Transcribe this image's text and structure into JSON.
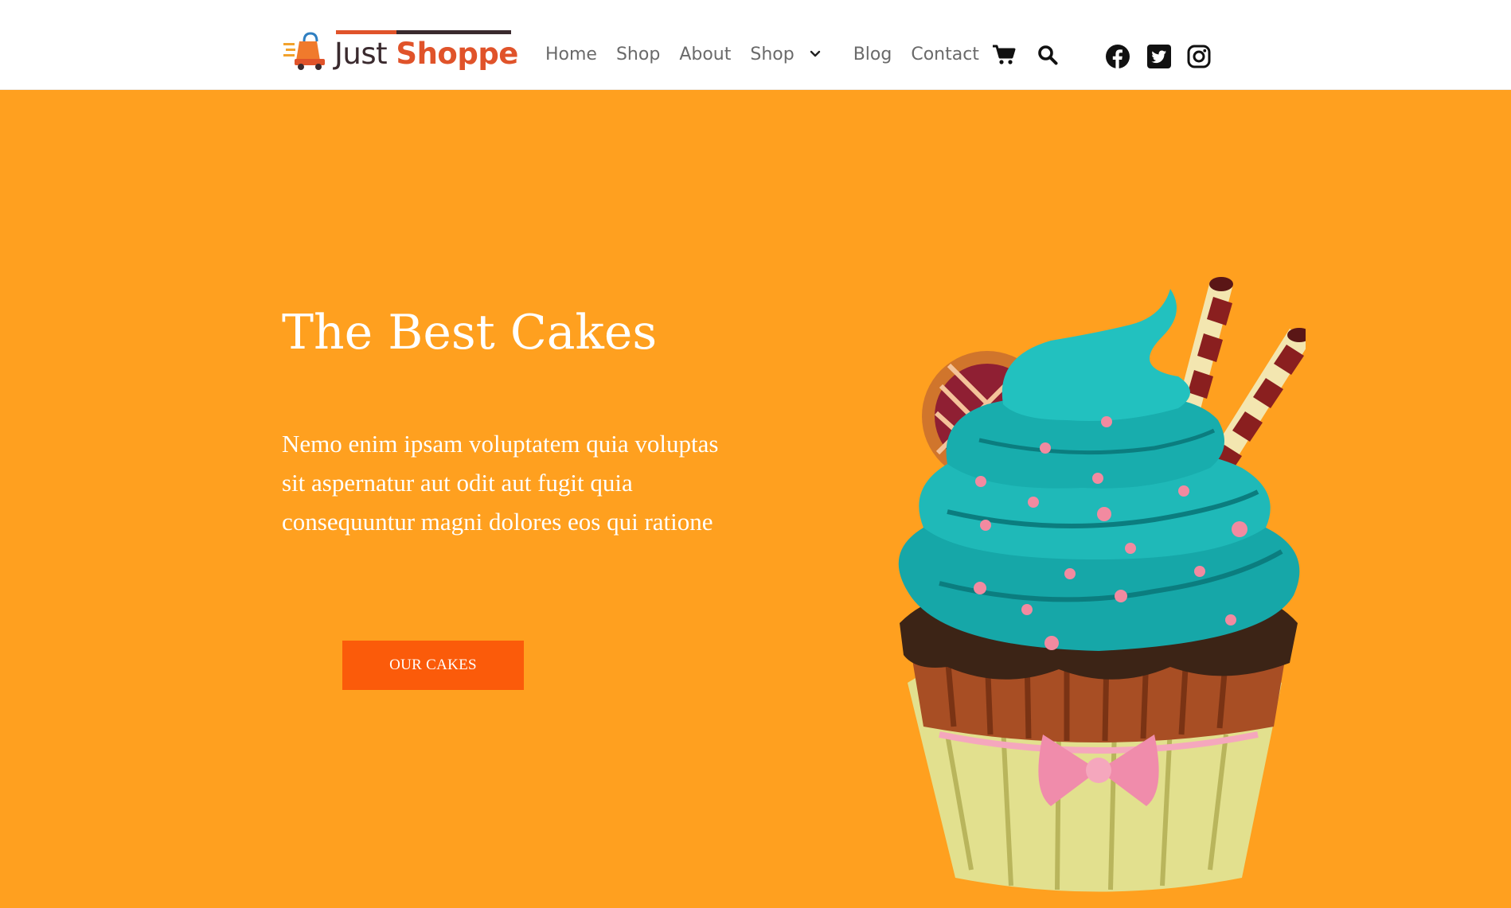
{
  "brand": {
    "name_part_1": "Just",
    "name_part_2": "Shoppe"
  },
  "nav": {
    "items": [
      "Home",
      "Shop",
      "About",
      "Shop"
    ],
    "items_after_dropdown": [
      "Blog",
      "Contact"
    ]
  },
  "icons": {
    "dropdown": "chevron-down-icon",
    "cart": "cart-icon",
    "search": "search-icon",
    "social": [
      "facebook-icon",
      "twitter-icon",
      "instagram-icon"
    ]
  },
  "hero": {
    "title": "The Best Cakes",
    "text": "Nemo enim ipsam voluptatem quia voluptas sit aspernatur aut odit aut fugit quia consequuntur magni dolores eos qui ratione",
    "button_label": "OUR CAKES",
    "image": "cupcake-illustration"
  },
  "colors": {
    "hero_background": "#ffa01f",
    "button": "#fb5b0a",
    "brand_accent": "#e0532a",
    "brand_dark": "#3a2a2e",
    "nav_text": "#6a6a6a"
  }
}
